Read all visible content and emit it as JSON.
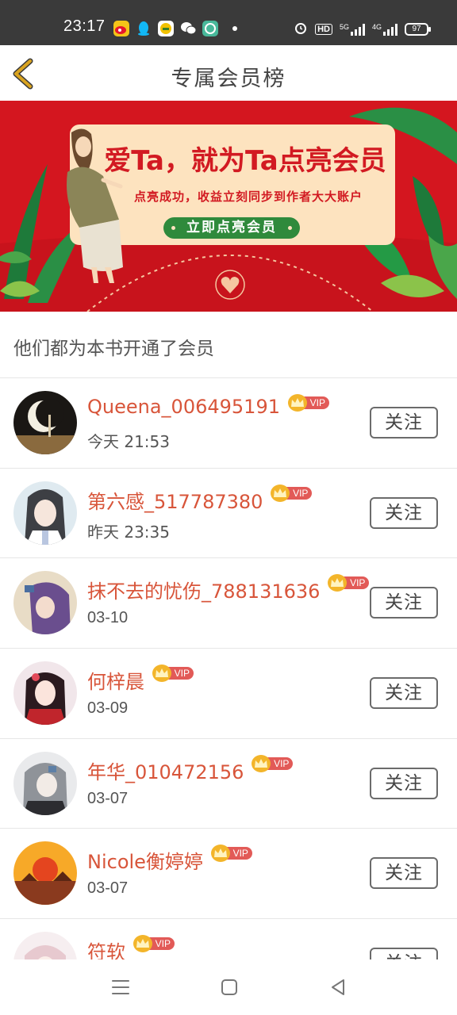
{
  "status_bar": {
    "time": "23:17",
    "app_icons": [
      "weibo-icon",
      "qq-icon",
      "qq-browser-icon",
      "wechat-icon",
      "app-icon"
    ],
    "network_1": "HD",
    "network_2": "5G",
    "network_3": "4G",
    "battery": "97"
  },
  "header": {
    "title": "专属会员榜",
    "back_icon": "chevron-left-icon",
    "accent": "#d9a31f"
  },
  "banner": {
    "headline": "爱Ta，就为Ta点亮会员",
    "subline": "点亮成功，收益立刻同步到作者大大账户",
    "cta": "立即点亮会员",
    "bg_color": "#d4161f"
  },
  "section": {
    "label": "他们都为本书开通了会员"
  },
  "members": [
    {
      "name": "Queena_006495191",
      "time": "今天 21:53",
      "badge": "VIP",
      "follow": "关注",
      "avatar": "avatar-moon"
    },
    {
      "name": "第六感_517787380",
      "time": "昨天 23:35",
      "badge": "VIP",
      "follow": "关注",
      "avatar": "avatar-anime-girl"
    },
    {
      "name": "抹不去的忧伤_788131636",
      "time": "03-10",
      "badge": "VIP",
      "follow": "关注",
      "avatar": "avatar-purple-hair"
    },
    {
      "name": "何梓晨",
      "time": "03-09",
      "badge": "VIP",
      "follow": "关注",
      "avatar": "avatar-kimono"
    },
    {
      "name": "年华_010472156",
      "time": "03-07",
      "badge": "VIP",
      "follow": "关注",
      "avatar": "avatar-gray-hair"
    },
    {
      "name": "Nicole衡婷婷",
      "time": "03-07",
      "badge": "VIP",
      "follow": "关注",
      "avatar": "avatar-sunset"
    },
    {
      "name": "符软",
      "time": "",
      "badge": "VIP",
      "follow": "关注",
      "avatar": "avatar-pink"
    }
  ],
  "nav_bar": {
    "icons": [
      "menu-icon",
      "home-icon",
      "back-icon"
    ]
  }
}
